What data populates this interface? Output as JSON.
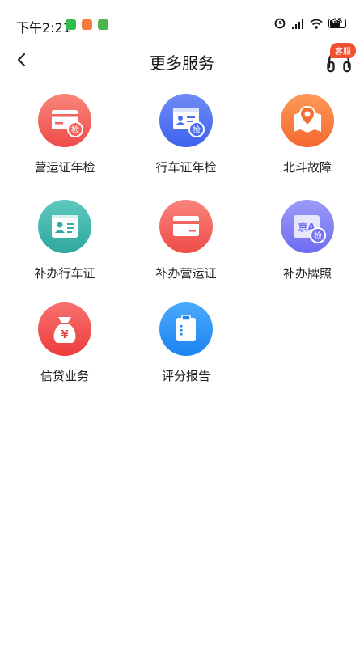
{
  "status_bar": {
    "time": "下午2:21",
    "battery": "65"
  },
  "header": {
    "title": "更多服务",
    "service_badge": "客服"
  },
  "services": [
    {
      "label": "营运证年检",
      "icon": "card-check-icon",
      "color_top": "#f9857b",
      "color_bottom": "#ef4c49"
    },
    {
      "label": "行车证年检",
      "icon": "id-card-check-icon",
      "color_top": "#6f8bf6",
      "color_bottom": "#3e63ee"
    },
    {
      "label": "北斗故障",
      "icon": "map-pin-icon",
      "color_top": "#fd9a59",
      "color_bottom": "#f4682e"
    },
    {
      "label": "补办行车证",
      "icon": "id-card-icon",
      "color_top": "#5fc9bf",
      "color_bottom": "#2fa79f"
    },
    {
      "label": "补办营运证",
      "icon": "card-icon",
      "color_top": "#f9857b",
      "color_bottom": "#ef4c49"
    },
    {
      "label": "补办牌照",
      "icon": "license-plate-icon",
      "color_top": "#9c9bf8",
      "color_bottom": "#6e6cf0"
    },
    {
      "label": "信贷业务",
      "icon": "money-bag-icon",
      "color_top": "#f7716f",
      "color_bottom": "#ec3d3d"
    },
    {
      "label": "评分报告",
      "icon": "report-icon",
      "color_top": "#4aaaf9",
      "color_bottom": "#1c83f1"
    }
  ]
}
